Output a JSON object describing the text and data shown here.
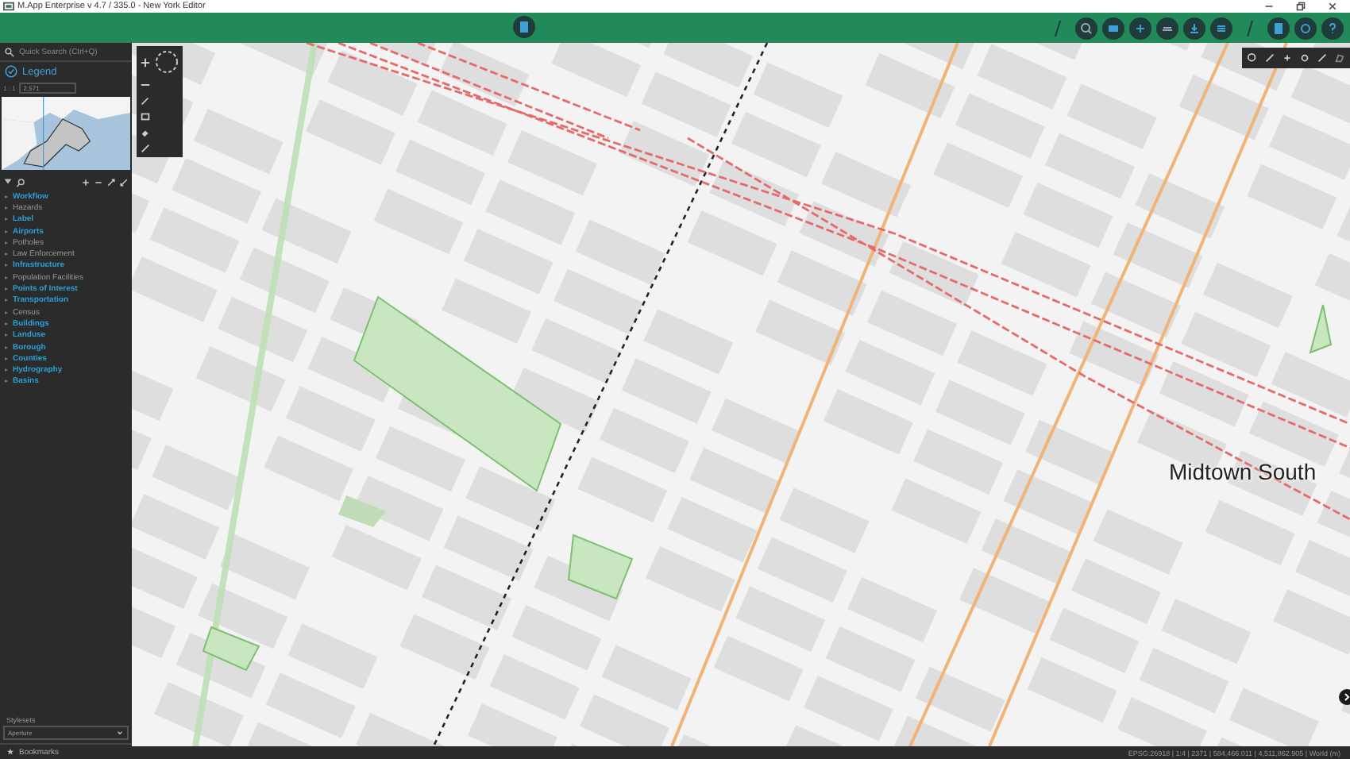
{
  "window": {
    "title": "M.App Enterprise v 4.7 / 335.0 - New York Editor"
  },
  "sidebar": {
    "search": {
      "placeholder": "Quick Search (Ctrl+Q)"
    },
    "legend_title": "Legend",
    "scale": {
      "prefix": "1 : 1",
      "value": "2,571"
    },
    "layers": [
      {
        "label": "Workflow",
        "kind": "group"
      },
      {
        "label": "Hazards",
        "kind": "layer"
      },
      {
        "label": "Label",
        "kind": "group"
      },
      {
        "label": "Airports",
        "kind": "group"
      },
      {
        "label": "Potholes",
        "kind": "layer"
      },
      {
        "label": "Law Enforcement",
        "kind": "layer"
      },
      {
        "label": "Infrastructure",
        "kind": "group"
      },
      {
        "label": "Population Facilities",
        "kind": "layer"
      },
      {
        "label": "Points of Interest",
        "kind": "group"
      },
      {
        "label": "Transportation",
        "kind": "group"
      },
      {
        "label": "Census",
        "kind": "layer"
      },
      {
        "label": "Buildings",
        "kind": "group"
      },
      {
        "label": "Landuse",
        "kind": "group"
      },
      {
        "label": "Borough",
        "kind": "group"
      },
      {
        "label": "Counties",
        "kind": "group"
      },
      {
        "label": "Hydrography",
        "kind": "group"
      },
      {
        "label": "Basins",
        "kind": "group"
      }
    ],
    "stylesets": {
      "label": "Stylesets",
      "value": "Aperture"
    },
    "bookmarks": "Bookmarks"
  },
  "map": {
    "place_label": "Midtown South"
  },
  "status_bar": {
    "text": "EPSG:26918 | 1:4 | 2371 | 584,466.011 | 4,511,862.905 | World (m)"
  }
}
